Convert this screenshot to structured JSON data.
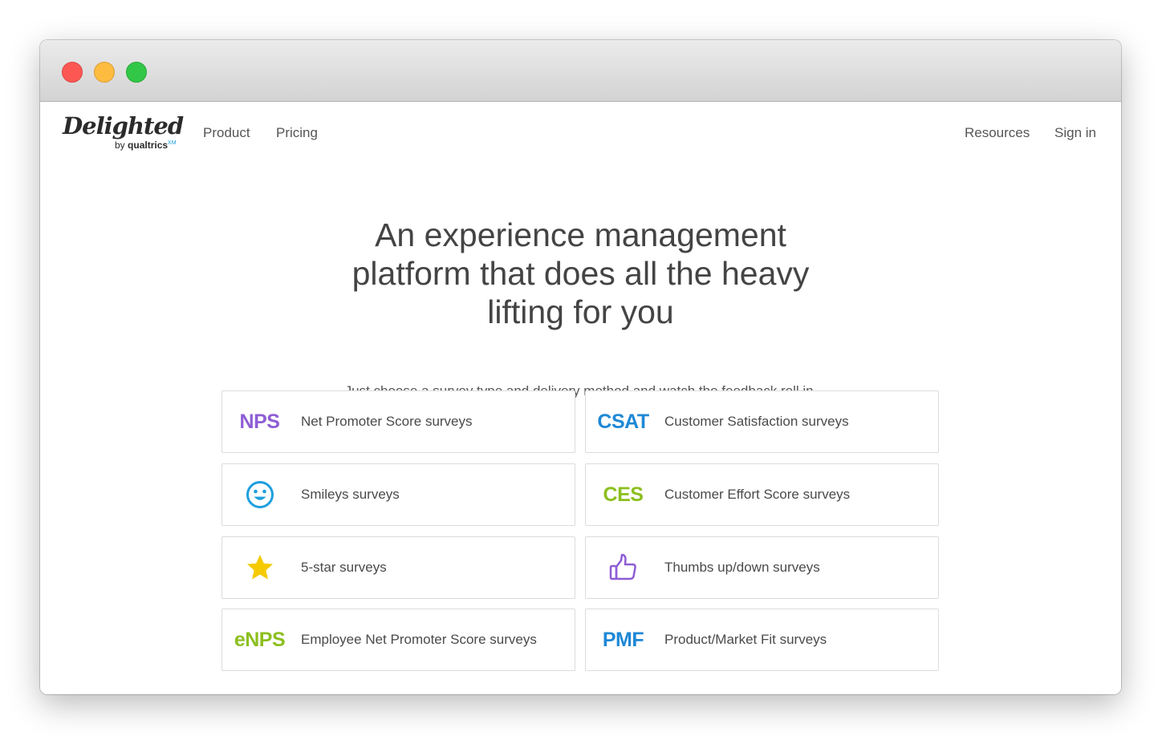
{
  "logo": {
    "wordmark": "Delighted",
    "byline": "by",
    "parent_brand": "qualtrics",
    "trademark": "XM"
  },
  "nav": {
    "product": "Product",
    "pricing": "Pricing",
    "resources": "Resources",
    "sign_in": "Sign in"
  },
  "hero": {
    "title_line1": "An experience management",
    "title_line2": "platform that does all the heavy",
    "title_line3": "lifting for you",
    "subtitle": "Just choose a survey type and delivery method and watch the feedback roll in."
  },
  "surveys": [
    {
      "badge": "NPS",
      "label": "Net Promoter Score surveys",
      "color": "#8e5dd5"
    },
    {
      "badge": "CSAT",
      "label": "Customer Satisfaction surveys",
      "color": "#1e88d6"
    },
    {
      "icon": "smiley-icon",
      "label": "Smileys surveys",
      "color": "#1e9fe0"
    },
    {
      "badge": "CES",
      "label": "Customer Effort Score surveys",
      "color": "#8cbf1f"
    },
    {
      "icon": "star-icon",
      "label": "5-star surveys",
      "color": "#f5ca00"
    },
    {
      "icon": "thumbs-up-icon",
      "label": "Thumbs up/down surveys",
      "color": "#8e5dd5"
    },
    {
      "badge": "eNPS",
      "label": "Employee Net Promoter Score surveys",
      "color": "#8cbf1f"
    },
    {
      "badge": "PMF",
      "label": "Product/Market Fit surveys",
      "color": "#1e88d6"
    }
  ]
}
